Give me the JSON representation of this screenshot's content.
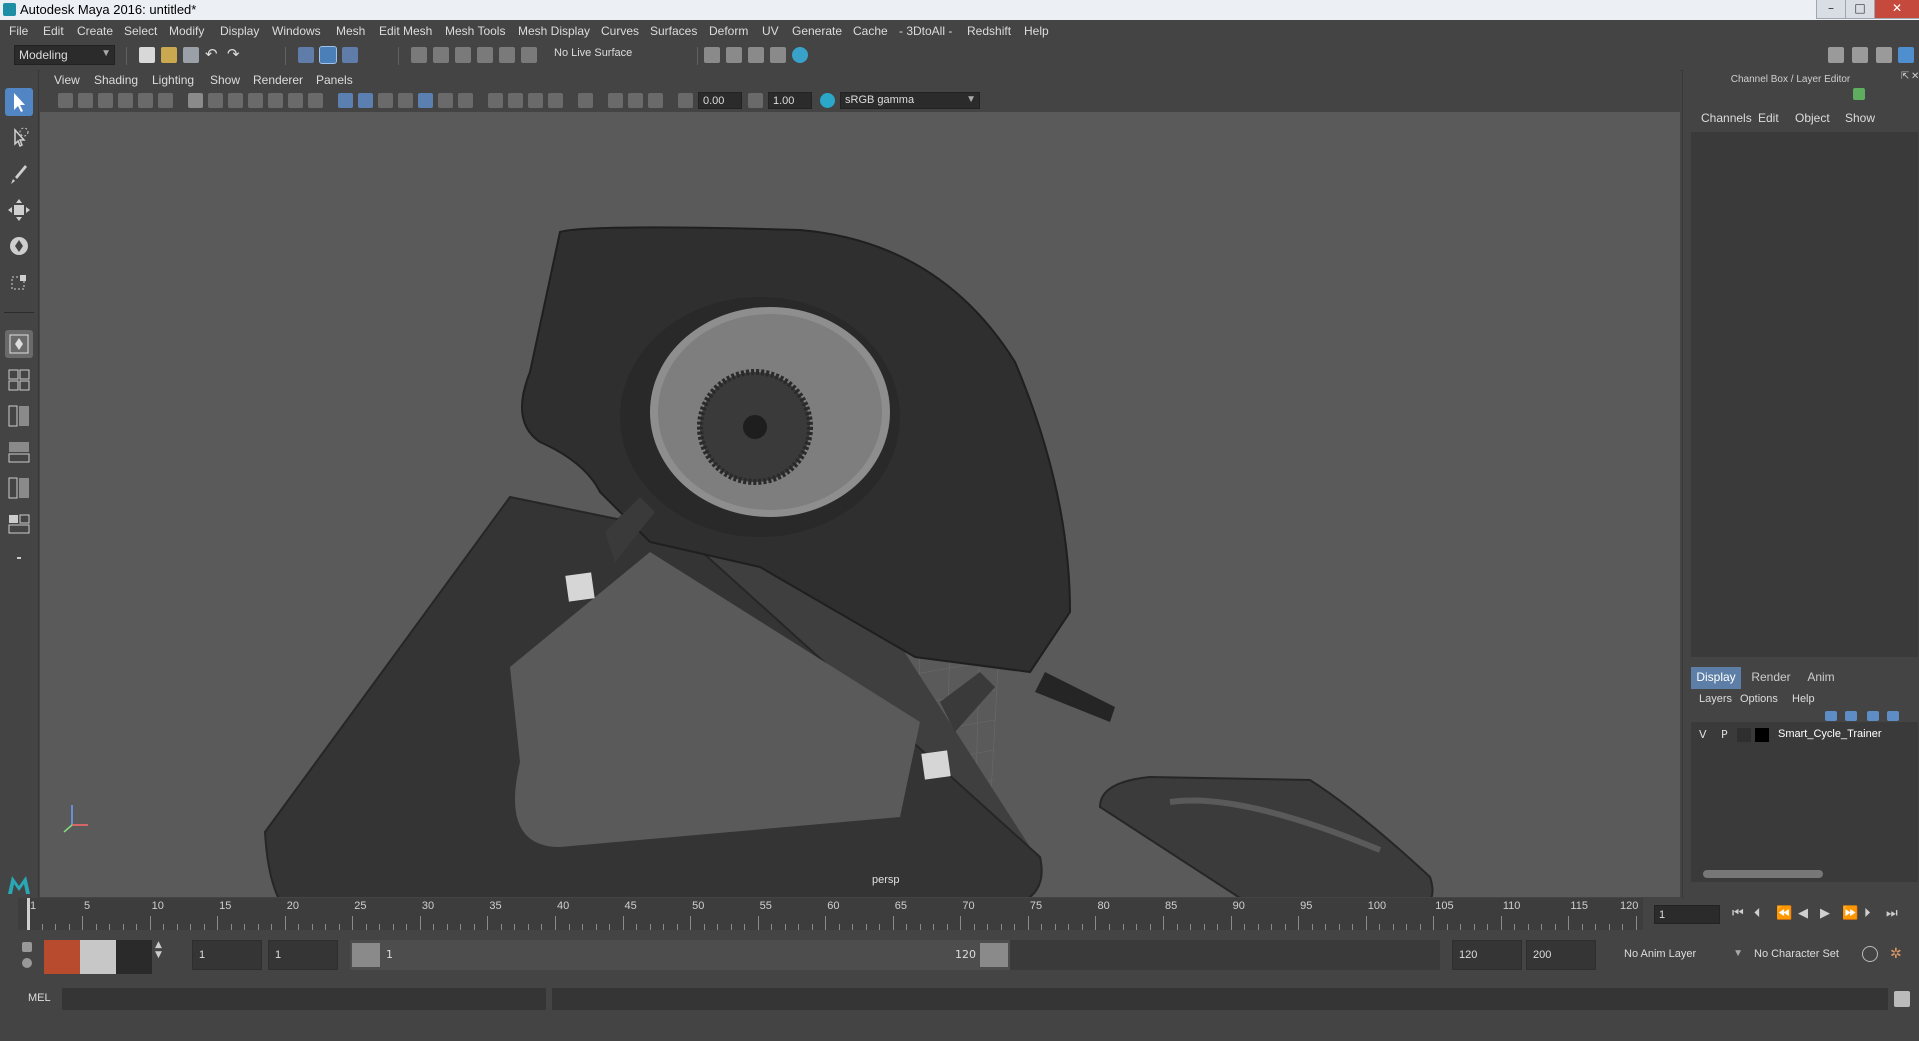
{
  "window": {
    "title": "Autodesk Maya 2016: untitled*",
    "buttons": [
      "–",
      "□",
      "✕"
    ]
  },
  "menubar": {
    "items": [
      "File",
      "Edit",
      "Create",
      "Select",
      "Modify",
      "Display",
      "Windows",
      "Mesh",
      "Edit Mesh",
      "Mesh Tools",
      "Mesh Display",
      "Curves",
      "Surfaces",
      "Deform",
      "UV",
      "Generate",
      "Cache",
      "- 3DtoAll -",
      "Redshift",
      "Help"
    ]
  },
  "shelf": {
    "mode": "Modeling",
    "live_surface": "No Live Surface"
  },
  "viewport": {
    "menu": [
      "View",
      "Shading",
      "Lighting",
      "Show",
      "Renderer",
      "Panels"
    ],
    "exposure": "0.00",
    "gamma": "1.00",
    "color_space": "sRGB gamma",
    "camera_label": "persp"
  },
  "channel_box": {
    "title": "Channel Box / Layer Editor",
    "menu": [
      "Channels",
      "Edit",
      "Object",
      "Show"
    ]
  },
  "layer_editor": {
    "tabs": [
      "Display",
      "Render",
      "Anim"
    ],
    "menu": [
      "Layers",
      "Options",
      "Help"
    ],
    "layers": [
      {
        "v": "V",
        "p": "P",
        "name": "Smart_Cycle_Trainer",
        "color": "#000000"
      }
    ]
  },
  "timeline": {
    "ticks": [
      "1",
      "5",
      "10",
      "15",
      "20",
      "25",
      "30",
      "35",
      "40",
      "45",
      "50",
      "55",
      "60",
      "65",
      "70",
      "75",
      "80",
      "85",
      "90",
      "95",
      "100",
      "105",
      "110",
      "115",
      "120"
    ],
    "current_frame": "1"
  },
  "range": {
    "start": "1",
    "anim_start": "1",
    "slider_start": "1",
    "slider_end": "120",
    "end": "120",
    "anim_end": "200",
    "anim_layer": "No Anim Layer",
    "character_set": "No Character Set"
  },
  "command_line": {
    "label": "MEL",
    "value": ""
  }
}
